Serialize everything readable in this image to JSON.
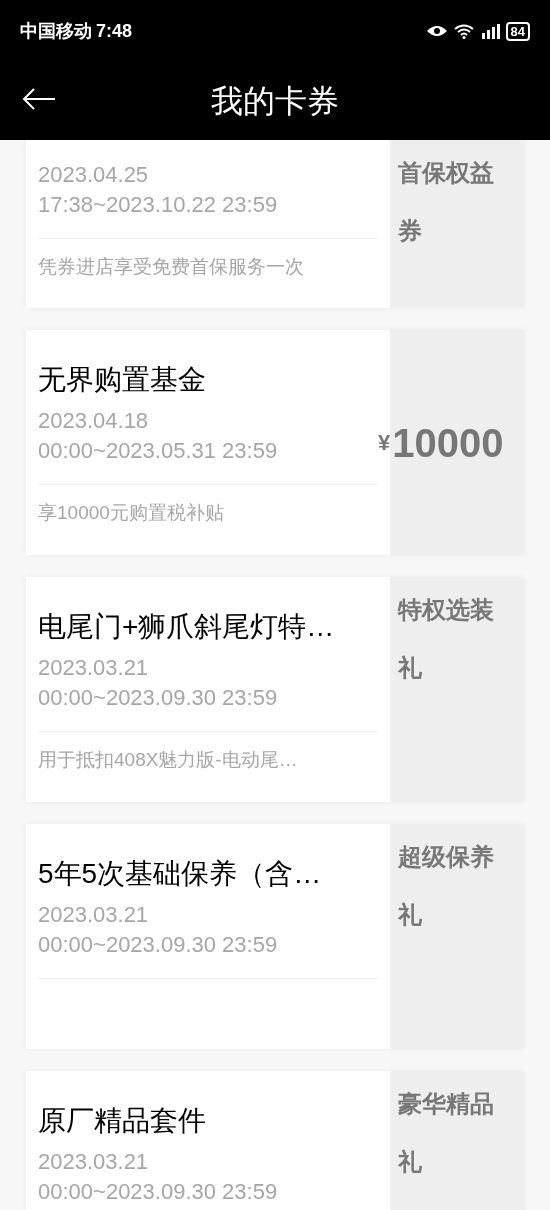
{
  "status_bar": {
    "carrier": "中国移动",
    "time": "7:48",
    "battery": "84"
  },
  "header": {
    "title": "我的卡券"
  },
  "coupons": [
    {
      "date_lines": [
        "2023.04.25",
        "17:38~2023.10.22 23:59"
      ],
      "description": "凭券进店享受免费首保服务一次",
      "panel": {
        "kind": "label",
        "text": "首保权益券"
      }
    },
    {
      "title": "无界购置基金",
      "date_lines": [
        "2023.04.18",
        "00:00~2023.05.31 23:59"
      ],
      "description": "享10000元购置税补贴",
      "panel": {
        "kind": "amount",
        "currency": "¥",
        "value": "10000"
      }
    },
    {
      "title": "电尾门+狮爪斜尾灯特…",
      "date_lines": [
        "2023.03.21",
        "00:00~2023.09.30 23:59"
      ],
      "description": "用于抵扣408X魅力版-电动尾…",
      "panel": {
        "kind": "label",
        "text": "特权选装礼"
      }
    },
    {
      "title": "5年5次基础保养（含…",
      "date_lines": [
        "2023.03.21",
        "00:00~2023.09.30 23:59"
      ],
      "panel": {
        "kind": "label",
        "text": "超级保养礼"
      }
    },
    {
      "title": "原厂精品套件",
      "date_lines": [
        "2023.03.21",
        "00:00~2023.09.30 23:59"
      ],
      "panel": {
        "kind": "label",
        "text": "豪华精品礼"
      }
    }
  ]
}
